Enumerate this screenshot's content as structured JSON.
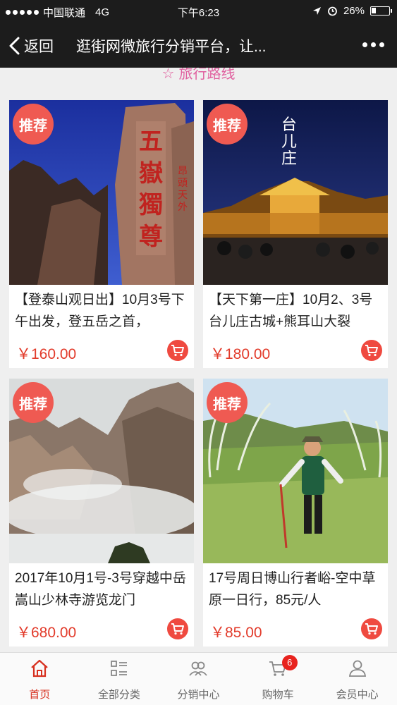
{
  "status_bar": {
    "carrier": "中国联通",
    "network": "4G",
    "time": "下午6:23",
    "battery": "26%"
  },
  "nav": {
    "back_label": "返回",
    "title": "逛街网微旅行分销平台，让..."
  },
  "section": {
    "title": "旅行路线"
  },
  "products": [
    {
      "badge": "推荐",
      "title": "【登泰山观日出】10月3号下午出发，登五岳之首，",
      "price": "￥160.00",
      "image_text": "五嶽獨尊",
      "image_side_text": "昂頭天外"
    },
    {
      "badge": "推荐",
      "title": "【天下第一庄】10月2、3号台儿庄古城+熊耳山大裂",
      "price": "￥180.00",
      "image_text": "台儿庄"
    },
    {
      "badge": "推荐",
      "title": "2017年10月1号-3号穿越中岳嵩山少林寺游览龙门",
      "price": "￥680.00"
    },
    {
      "badge": "推荐",
      "title": "17号周日博山行者峪-空中草原一日行，85元/人",
      "price": "￥85.00"
    }
  ],
  "tabs": [
    {
      "label": "首页",
      "icon": "home-icon",
      "active": true
    },
    {
      "label": "全部分类",
      "icon": "category-icon"
    },
    {
      "label": "分销中心",
      "icon": "distribution-icon"
    },
    {
      "label": "购物车",
      "icon": "cart-icon",
      "badge": "6"
    },
    {
      "label": "会员中心",
      "icon": "member-icon"
    }
  ],
  "colors": {
    "accent": "#d7301f",
    "badge": "#ef5a52",
    "price": "#e23b2b",
    "section": "#e0609f"
  }
}
